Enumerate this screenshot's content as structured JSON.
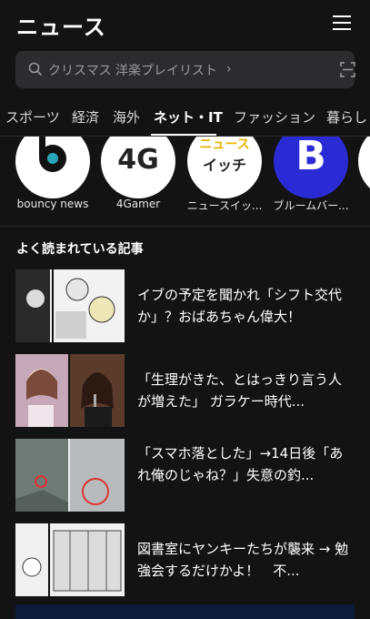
{
  "header": {
    "title": "ニュース"
  },
  "search": {
    "placeholder": "クリスマス 洋楽プレイリスト",
    "chevron": "›"
  },
  "tabs": [
    {
      "label": "スポーツ"
    },
    {
      "label": "経済"
    },
    {
      "label": "海外"
    },
    {
      "label": "ネット・IT",
      "active": true
    },
    {
      "label": "ファッション"
    },
    {
      "label": "暮らし"
    }
  ],
  "media": [
    {
      "name": "bouncy news"
    },
    {
      "name": "4Gamer",
      "logo_text": "4G"
    },
    {
      "name": "ニュースイッ...",
      "logo_text": [
        "ニュース",
        "イッチ"
      ]
    },
    {
      "name": "ブルームバー...",
      "logo_text": "B"
    }
  ],
  "popular": {
    "title": "よく読まれている記事",
    "articles": [
      {
        "headline": "イブの予定を聞かれ「シフト交代か」？おばあちゃん偉大！"
      },
      {
        "headline": "「生理がきた、とはっきり言う人が増えた」 ガラケー時代..."
      },
      {
        "headline": "「スマホ落とした」→14日後「あれ俺のじゃね？」失意の釣..."
      },
      {
        "headline": "図書室にヤンキーたちが襲来 → 勉強会するだけかよ！　不..."
      }
    ]
  },
  "colors": {
    "background": "#131313",
    "search_bg": "#2c2c2e",
    "bloomberg_blue": "#2b2bd6",
    "bouncy_teal": "#2aa8b8"
  },
  "icons": {
    "menu": "hamburger-menu-icon",
    "search": "search-icon",
    "scan": "scan-icon"
  }
}
